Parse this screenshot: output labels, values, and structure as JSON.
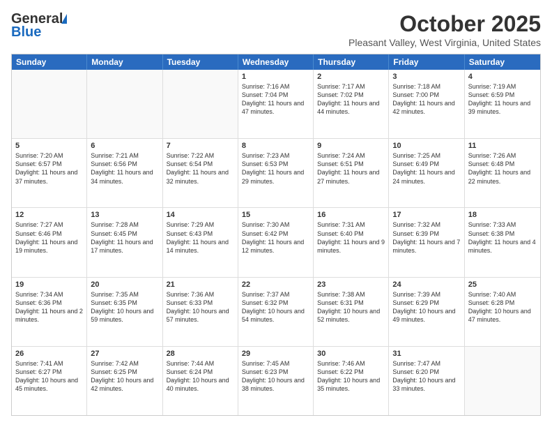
{
  "header": {
    "logo_general": "General",
    "logo_blue": "Blue",
    "month_title": "October 2025",
    "location": "Pleasant Valley, West Virginia, United States"
  },
  "days_of_week": [
    "Sunday",
    "Monday",
    "Tuesday",
    "Wednesday",
    "Thursday",
    "Friday",
    "Saturday"
  ],
  "weeks": [
    [
      {
        "num": "",
        "info": ""
      },
      {
        "num": "",
        "info": ""
      },
      {
        "num": "",
        "info": ""
      },
      {
        "num": "1",
        "info": "Sunrise: 7:16 AM\nSunset: 7:04 PM\nDaylight: 11 hours and 47 minutes."
      },
      {
        "num": "2",
        "info": "Sunrise: 7:17 AM\nSunset: 7:02 PM\nDaylight: 11 hours and 44 minutes."
      },
      {
        "num": "3",
        "info": "Sunrise: 7:18 AM\nSunset: 7:00 PM\nDaylight: 11 hours and 42 minutes."
      },
      {
        "num": "4",
        "info": "Sunrise: 7:19 AM\nSunset: 6:59 PM\nDaylight: 11 hours and 39 minutes."
      }
    ],
    [
      {
        "num": "5",
        "info": "Sunrise: 7:20 AM\nSunset: 6:57 PM\nDaylight: 11 hours and 37 minutes."
      },
      {
        "num": "6",
        "info": "Sunrise: 7:21 AM\nSunset: 6:56 PM\nDaylight: 11 hours and 34 minutes."
      },
      {
        "num": "7",
        "info": "Sunrise: 7:22 AM\nSunset: 6:54 PM\nDaylight: 11 hours and 32 minutes."
      },
      {
        "num": "8",
        "info": "Sunrise: 7:23 AM\nSunset: 6:53 PM\nDaylight: 11 hours and 29 minutes."
      },
      {
        "num": "9",
        "info": "Sunrise: 7:24 AM\nSunset: 6:51 PM\nDaylight: 11 hours and 27 minutes."
      },
      {
        "num": "10",
        "info": "Sunrise: 7:25 AM\nSunset: 6:49 PM\nDaylight: 11 hours and 24 minutes."
      },
      {
        "num": "11",
        "info": "Sunrise: 7:26 AM\nSunset: 6:48 PM\nDaylight: 11 hours and 22 minutes."
      }
    ],
    [
      {
        "num": "12",
        "info": "Sunrise: 7:27 AM\nSunset: 6:46 PM\nDaylight: 11 hours and 19 minutes."
      },
      {
        "num": "13",
        "info": "Sunrise: 7:28 AM\nSunset: 6:45 PM\nDaylight: 11 hours and 17 minutes."
      },
      {
        "num": "14",
        "info": "Sunrise: 7:29 AM\nSunset: 6:43 PM\nDaylight: 11 hours and 14 minutes."
      },
      {
        "num": "15",
        "info": "Sunrise: 7:30 AM\nSunset: 6:42 PM\nDaylight: 11 hours and 12 minutes."
      },
      {
        "num": "16",
        "info": "Sunrise: 7:31 AM\nSunset: 6:40 PM\nDaylight: 11 hours and 9 minutes."
      },
      {
        "num": "17",
        "info": "Sunrise: 7:32 AM\nSunset: 6:39 PM\nDaylight: 11 hours and 7 minutes."
      },
      {
        "num": "18",
        "info": "Sunrise: 7:33 AM\nSunset: 6:38 PM\nDaylight: 11 hours and 4 minutes."
      }
    ],
    [
      {
        "num": "19",
        "info": "Sunrise: 7:34 AM\nSunset: 6:36 PM\nDaylight: 11 hours and 2 minutes."
      },
      {
        "num": "20",
        "info": "Sunrise: 7:35 AM\nSunset: 6:35 PM\nDaylight: 10 hours and 59 minutes."
      },
      {
        "num": "21",
        "info": "Sunrise: 7:36 AM\nSunset: 6:33 PM\nDaylight: 10 hours and 57 minutes."
      },
      {
        "num": "22",
        "info": "Sunrise: 7:37 AM\nSunset: 6:32 PM\nDaylight: 10 hours and 54 minutes."
      },
      {
        "num": "23",
        "info": "Sunrise: 7:38 AM\nSunset: 6:31 PM\nDaylight: 10 hours and 52 minutes."
      },
      {
        "num": "24",
        "info": "Sunrise: 7:39 AM\nSunset: 6:29 PM\nDaylight: 10 hours and 49 minutes."
      },
      {
        "num": "25",
        "info": "Sunrise: 7:40 AM\nSunset: 6:28 PM\nDaylight: 10 hours and 47 minutes."
      }
    ],
    [
      {
        "num": "26",
        "info": "Sunrise: 7:41 AM\nSunset: 6:27 PM\nDaylight: 10 hours and 45 minutes."
      },
      {
        "num": "27",
        "info": "Sunrise: 7:42 AM\nSunset: 6:25 PM\nDaylight: 10 hours and 42 minutes."
      },
      {
        "num": "28",
        "info": "Sunrise: 7:44 AM\nSunset: 6:24 PM\nDaylight: 10 hours and 40 minutes."
      },
      {
        "num": "29",
        "info": "Sunrise: 7:45 AM\nSunset: 6:23 PM\nDaylight: 10 hours and 38 minutes."
      },
      {
        "num": "30",
        "info": "Sunrise: 7:46 AM\nSunset: 6:22 PM\nDaylight: 10 hours and 35 minutes."
      },
      {
        "num": "31",
        "info": "Sunrise: 7:47 AM\nSunset: 6:20 PM\nDaylight: 10 hours and 33 minutes."
      },
      {
        "num": "",
        "info": ""
      }
    ]
  ]
}
